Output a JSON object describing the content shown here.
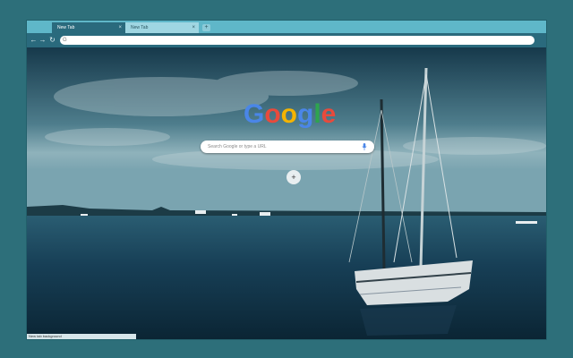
{
  "tabs": [
    {
      "label": "New Tab"
    },
    {
      "label": "New Tab"
    }
  ],
  "tab_close_glyph": "×",
  "new_tab_glyph": "+",
  "toolbar": {
    "back_glyph": "←",
    "forward_glyph": "→",
    "reload_glyph": "↻",
    "omnibox_icon": "G"
  },
  "logo_letters": [
    "G",
    "o",
    "o",
    "g",
    "l",
    "e"
  ],
  "search": {
    "placeholder": "Search Google or type a URL"
  },
  "shortcut_glyph": "+",
  "status_text": "New tab background",
  "colors": {
    "frame": "#5fb7c9",
    "toolbar": "#2a6a7d",
    "page_bg": "#2d6f7a"
  }
}
